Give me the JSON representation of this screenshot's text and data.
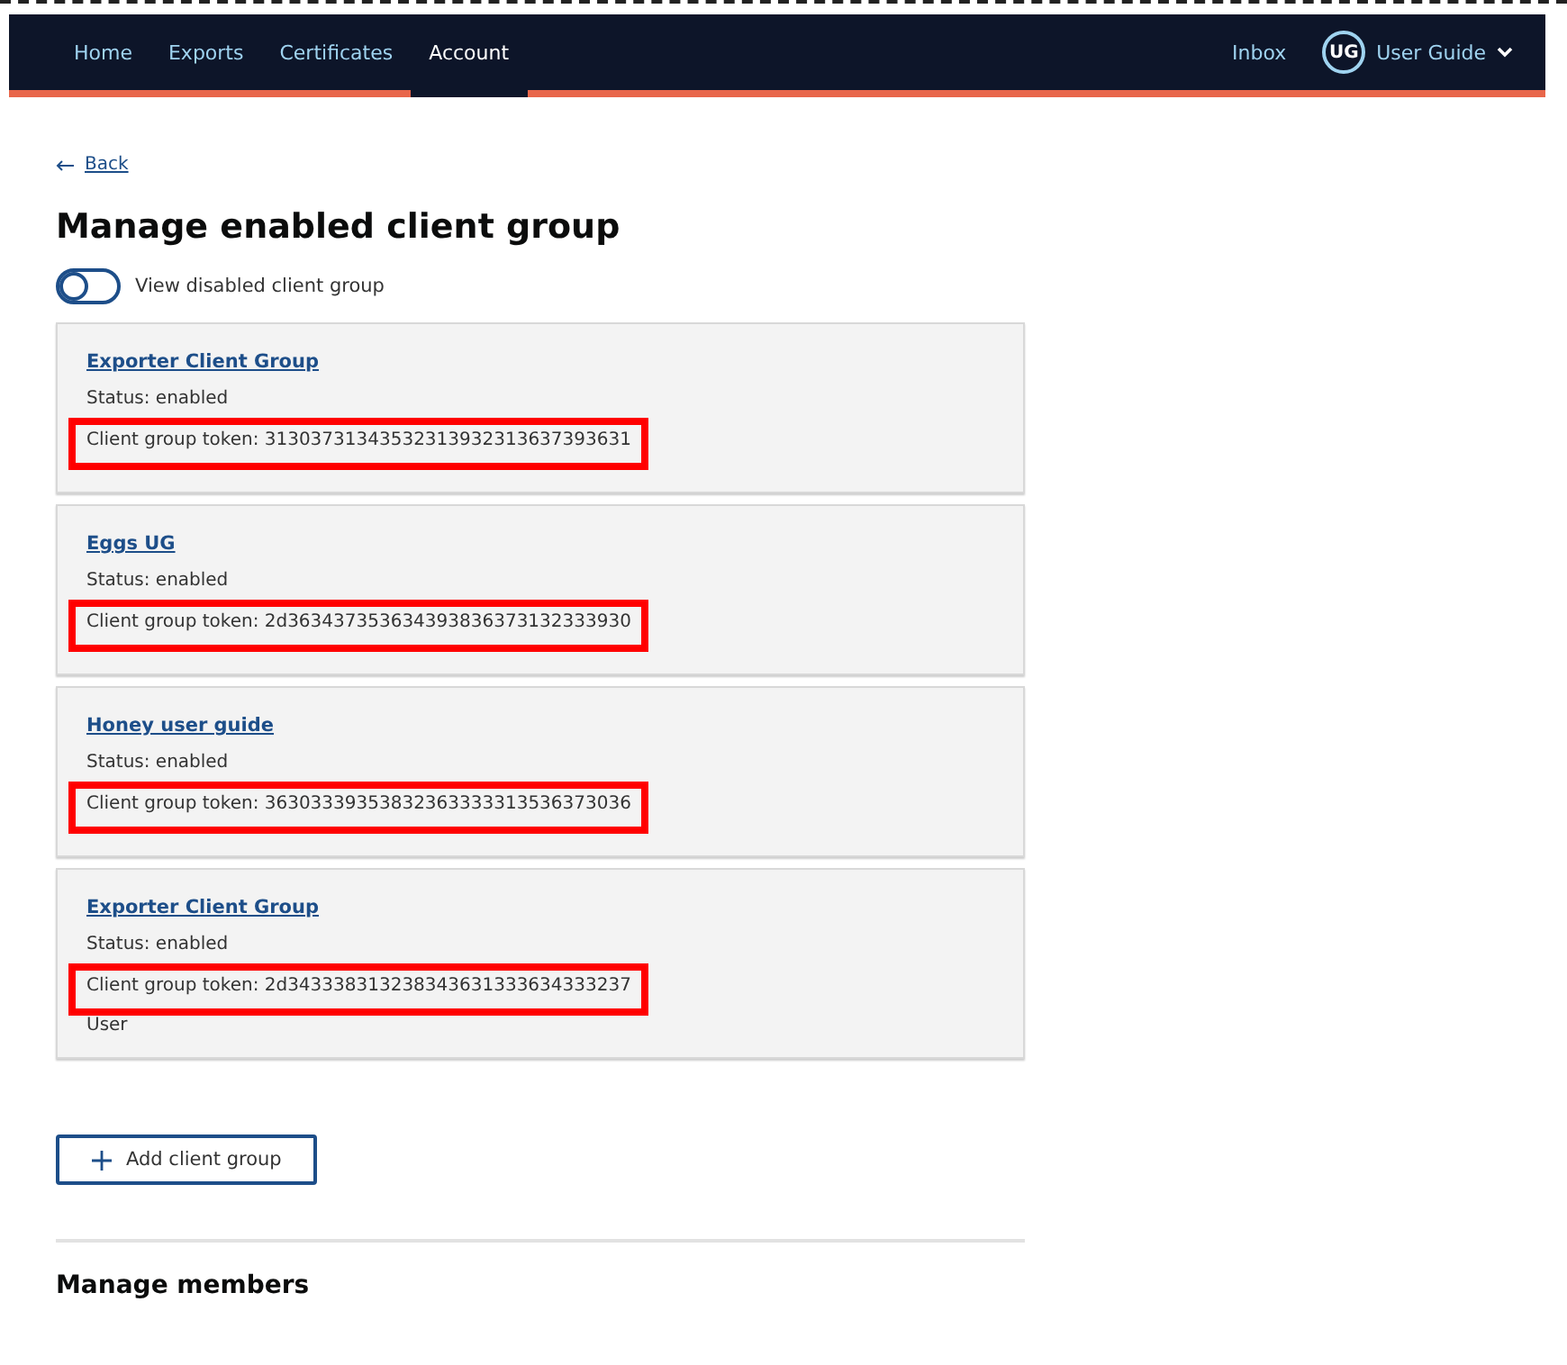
{
  "nav": {
    "items": [
      {
        "label": "Home",
        "selected": false
      },
      {
        "label": "Exports",
        "selected": false
      },
      {
        "label": "Certificates",
        "selected": false
      },
      {
        "label": "Account",
        "selected": true
      }
    ],
    "inbox": "Inbox",
    "user": {
      "initials": "UG",
      "name": "User Guide"
    }
  },
  "back": "Back",
  "title": "Manage enabled client group",
  "toggle": {
    "label": "View disabled client group",
    "on": false
  },
  "groups": [
    {
      "name": "Exporter Client Group",
      "status": "Status: enabled",
      "token": "Client group token: 31303731343532313932313637393631",
      "highlighted": true
    },
    {
      "name": "Eggs UG",
      "status": "Status: enabled",
      "token": "Client group token: 2d363437353634393836373132333930",
      "highlighted": true
    },
    {
      "name": "Honey user guide",
      "status": "Status: enabled",
      "token": "Client group token: 36303339353832363333313536373036",
      "highlighted": true
    },
    {
      "name": "Exporter Client Group",
      "status": "Status: enabled",
      "token": "Client group token: 2d343338313238343631333634333237",
      "highlighted": true,
      "note": "User"
    }
  ],
  "add_button": "Add client group",
  "members_heading": "Manage members"
}
